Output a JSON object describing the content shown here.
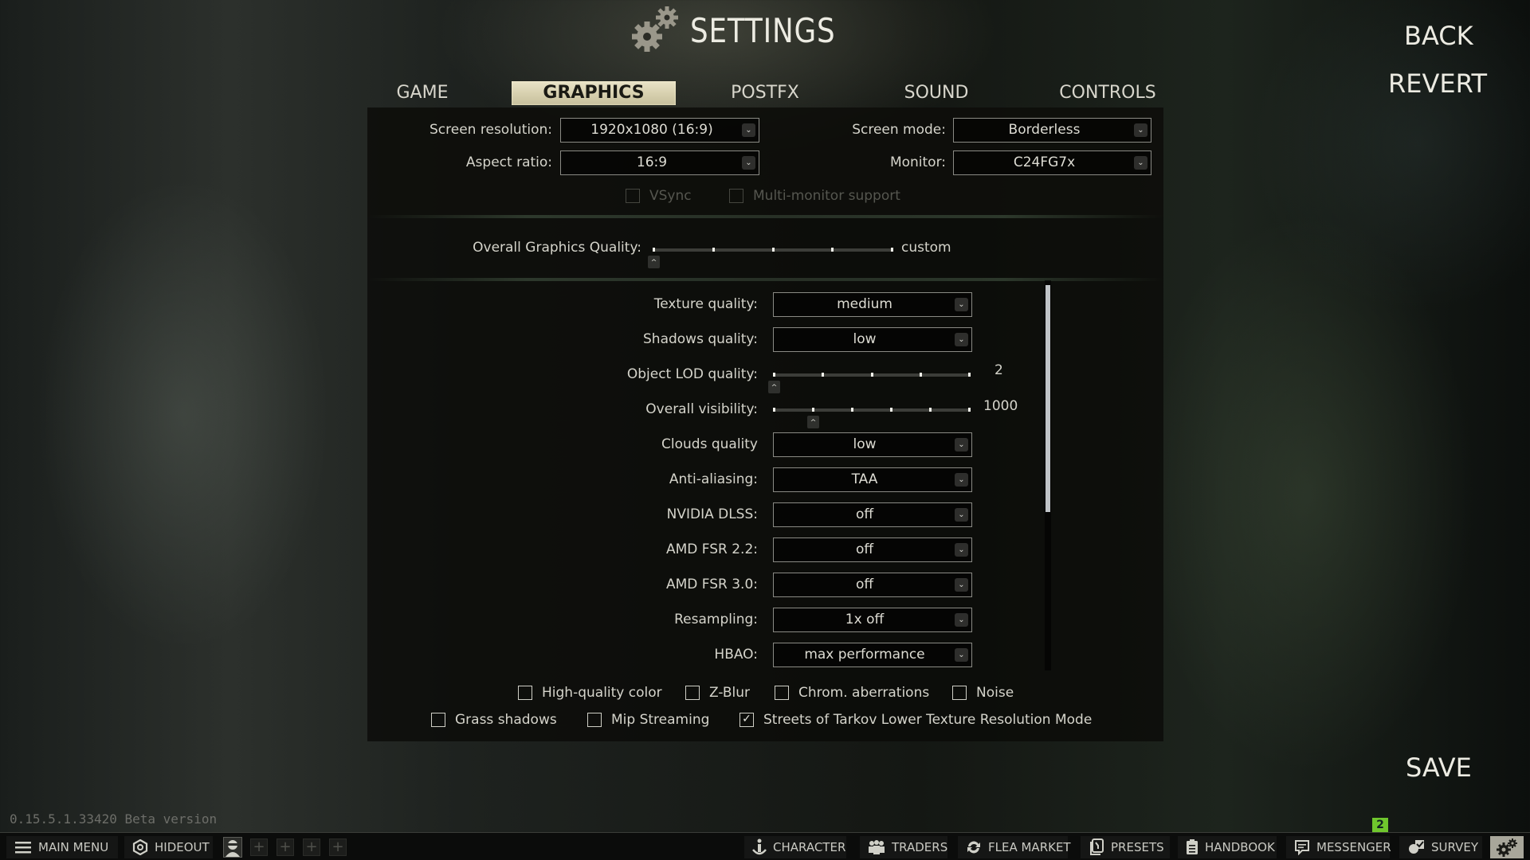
{
  "header": {
    "title": "SETTINGS",
    "icon": "gears-icon",
    "back_label": "BACK",
    "revert_label": "REVERT",
    "save_label": "SAVE"
  },
  "tabs": [
    {
      "label": "GAME",
      "active": false
    },
    {
      "label": "GRAPHICS",
      "active": true
    },
    {
      "label": "POSTFX",
      "active": false
    },
    {
      "label": "SOUND",
      "active": false
    },
    {
      "label": "CONTROLS",
      "active": false
    }
  ],
  "display": {
    "screen_resolution": {
      "label": "Screen resolution:",
      "value": "1920x1080 (16:9)"
    },
    "aspect_ratio": {
      "label": "Aspect ratio:",
      "value": "16:9"
    },
    "screen_mode": {
      "label": "Screen mode:",
      "value": "Borderless"
    },
    "monitor": {
      "label": "Monitor:",
      "value": "C24FG7x"
    },
    "vsync": {
      "label": "VSync",
      "checked": false,
      "enabled": false
    },
    "multi_monitor": {
      "label": "Multi-monitor support",
      "checked": false,
      "enabled": false
    }
  },
  "overall_quality": {
    "label": "Overall Graphics Quality:",
    "value_text": "custom",
    "steps": 5,
    "position_index": 0
  },
  "graphics": {
    "texture_quality": {
      "label": "Texture quality:",
      "value": "medium"
    },
    "shadows_quality": {
      "label": "Shadows quality:",
      "value": "low"
    },
    "object_lod": {
      "label": "Object LOD quality:",
      "value": "2",
      "steps": 5,
      "position_index": 0
    },
    "overall_visibility": {
      "label": "Overall visibility:",
      "value": "1000",
      "steps": 6,
      "position_index": 1
    },
    "clouds_quality": {
      "label": "Clouds quality",
      "value": "low"
    },
    "anti_aliasing": {
      "label": "Anti-aliasing:",
      "value": "TAA"
    },
    "nvidia_dlss": {
      "label": "NVIDIA DLSS:",
      "value": "off"
    },
    "amd_fsr22": {
      "label": "AMD FSR 2.2:",
      "value": "off"
    },
    "amd_fsr30": {
      "label": "AMD FSR 3.0:",
      "value": "off"
    },
    "resampling": {
      "label": "Resampling:",
      "value": "1x off"
    },
    "hbao": {
      "label": "HBAO:",
      "value": "max performance"
    }
  },
  "checkboxes": {
    "high_quality_color": {
      "label": "High-quality color",
      "checked": false
    },
    "z_blur": {
      "label": "Z-Blur",
      "checked": false
    },
    "chrom_aberrations": {
      "label": "Chrom. aberrations",
      "checked": false
    },
    "noise": {
      "label": "Noise",
      "checked": false
    },
    "grass_shadows": {
      "label": "Grass shadows",
      "checked": false
    },
    "mip_streaming": {
      "label": "Mip Streaming",
      "checked": false
    },
    "streets_lower_texture": {
      "label": "Streets of Tarkov Lower Texture Resolution Mode",
      "checked": true
    }
  },
  "footer": {
    "version": "0.15.5.1.33420 Beta version",
    "nav": [
      {
        "label": "MAIN MENU",
        "icon": "menu-icon"
      },
      {
        "label": "HIDEOUT",
        "icon": "hideout-icon"
      },
      {
        "label": "CHARACTER",
        "icon": "character-icon"
      },
      {
        "label": "TRADERS",
        "icon": "traders-icon"
      },
      {
        "label": "FLEA MARKET",
        "icon": "flea-market-icon"
      },
      {
        "label": "PRESETS",
        "icon": "presets-icon"
      },
      {
        "label": "HANDBOOK",
        "icon": "handbook-icon"
      },
      {
        "label": "MESSENGER",
        "icon": "messenger-icon"
      },
      {
        "label": "SURVEY",
        "icon": "survey-icon"
      }
    ],
    "messenger_badge": "2",
    "empty_slots": [
      "+",
      "+",
      "+",
      "+"
    ]
  },
  "colors": {
    "accent_tab_bg": "#d8d1b0",
    "badge_green": "#6fc62d",
    "scrollbar": "#c0c4c8"
  }
}
